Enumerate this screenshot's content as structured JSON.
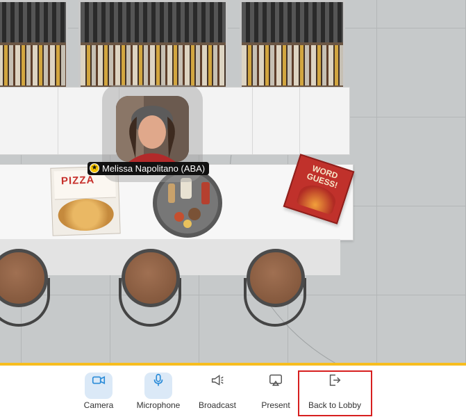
{
  "scene": {
    "avatar_name": "Melissa Napolitano (ABA)",
    "pizza_box_label": "PIZZA",
    "game_title": "WORD GUESS!"
  },
  "toolbar": {
    "items": [
      {
        "label": "Camera",
        "icon": "camera-icon",
        "active": true
      },
      {
        "label": "Microphone",
        "icon": "microphone-icon",
        "active": true
      },
      {
        "label": "Broadcast",
        "icon": "megaphone-icon",
        "active": false
      },
      {
        "label": "Present",
        "icon": "present-icon",
        "active": false
      },
      {
        "label": "Back to Lobby",
        "icon": "exit-icon",
        "active": false
      }
    ]
  },
  "colors": {
    "accent": "#f7bd1f",
    "active_icon_bg": "#dbe9f7",
    "active_icon": "#2a8bd8",
    "highlight": "#d71f1f"
  }
}
